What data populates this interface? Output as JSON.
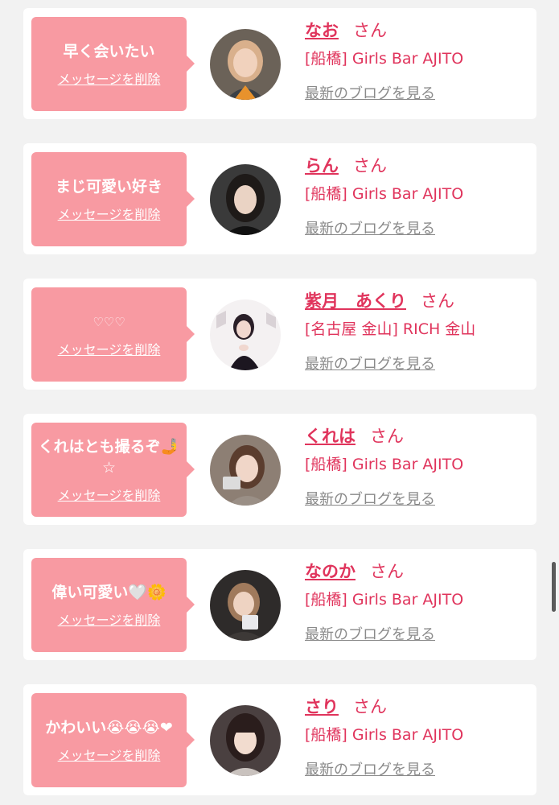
{
  "suffix": "さん",
  "delete_label": "メッセージを削除",
  "blog_label": "最新のブログを見る",
  "colors": {
    "bubble": "#f89aa2",
    "name": "#e0345c",
    "link_gray": "#8a8a8a"
  },
  "cards": [
    {
      "message": "早く会いたい",
      "name": "なお",
      "shop": "[船橋] Girls Bar AJITO",
      "avatar": "avatar-nao"
    },
    {
      "message": "まじ可愛い好き",
      "name": "らん",
      "shop": "[船橋] Girls Bar AJITO",
      "avatar": "avatar-ran"
    },
    {
      "message": "♡♡♡",
      "name": "紫月　あくり",
      "shop": "[名古屋 金山] RICH 金山",
      "avatar": "avatar-akuri"
    },
    {
      "message": "くれはとも撮るぞ🤳☆",
      "name": "くれは",
      "shop": "[船橋] Girls Bar AJITO",
      "avatar": "avatar-kureha"
    },
    {
      "message": "偉い可愛い🤍🌼",
      "name": "なのか",
      "shop": "[船橋] Girls Bar AJITO",
      "avatar": "avatar-nanoka"
    },
    {
      "message": "かわいい😭😭😭❤",
      "name": "さり",
      "shop": "[船橋] Girls Bar AJITO",
      "avatar": "avatar-sari"
    }
  ]
}
